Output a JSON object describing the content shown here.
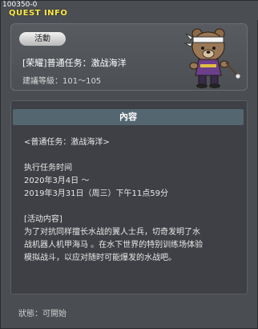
{
  "window": {
    "quest_id": "100350-0",
    "title": "QUEST INFO"
  },
  "header": {
    "badge": "活動",
    "quest_title": "[荣耀]普通任务：激战海洋",
    "recommend": "建議等級：101～105"
  },
  "content": {
    "section_title": "內容",
    "lines": [
      "<普通任务：激战海洋>",
      "",
      "执行任务时间",
      "2020年3月4日 ～",
      "2019年3月31日（周三）下午11点59分",
      "",
      "[活动内容]",
      "为了对抗同样擅长水战的翼人士兵，切奇发明了水",
      "战机器人机甲海马 。在水下世界的特别训练场体验",
      "模拟战斗，以应对随时可能爆发的水战吧。"
    ]
  },
  "footer": {
    "status": "狀態：可開始"
  }
}
